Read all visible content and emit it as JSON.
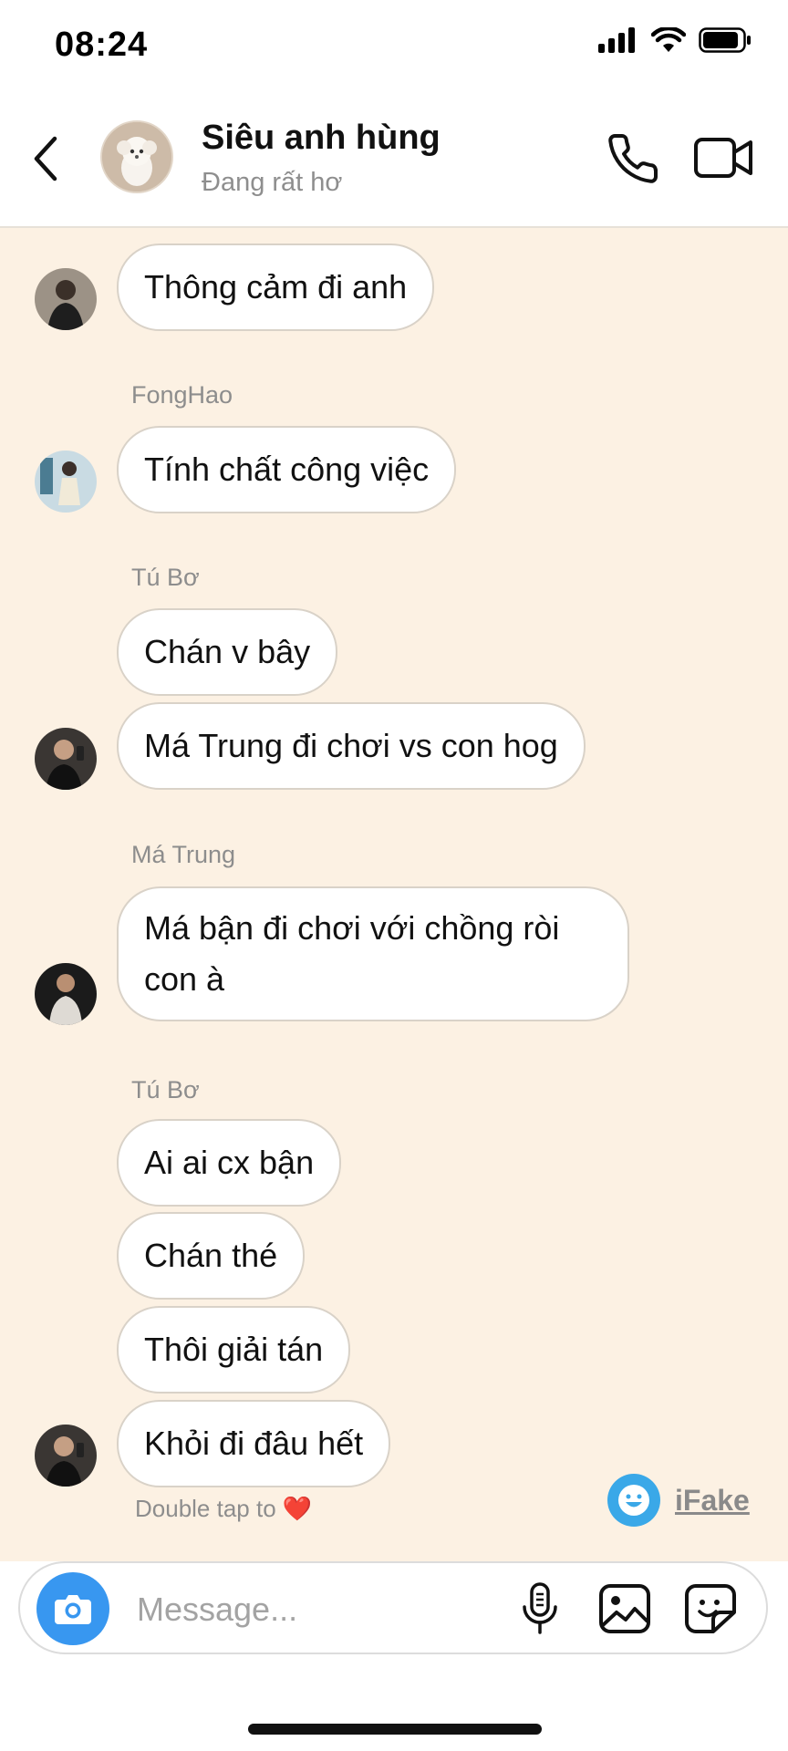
{
  "status_bar": {
    "time": "08:24"
  },
  "header": {
    "title": "Siêu anh hùng",
    "status": "Đang rất hơ"
  },
  "messages": [
    {
      "text": "Thông cảm đi anh"
    },
    {
      "sender": "FongHao",
      "text": "Tính chất công việc"
    },
    {
      "sender": "Tú Bơ",
      "text": "Chán v bây"
    },
    {
      "text": "Má Trung đi chơi vs con hog"
    },
    {
      "sender": "Má Trung",
      "text": "Má bận đi chơi với chồng ròi con à"
    },
    {
      "sender": "Tú Bơ",
      "text": "Ai ai cx bận"
    },
    {
      "text": "Chán thé"
    },
    {
      "text": "Thôi giải tán"
    },
    {
      "text": "Khỏi đi đâu hết"
    }
  ],
  "double_tap": {
    "text": "Double tap to",
    "heart": "❤️"
  },
  "watermark": {
    "text": "iFake"
  },
  "composer": {
    "placeholder": "Message..."
  },
  "icons": {
    "back": "chevron-left-icon",
    "call": "phone-icon",
    "video": "video-camera-icon",
    "camera": "camera-icon",
    "mic": "microphone-icon",
    "gallery": "image-icon",
    "sticker": "sticker-icon"
  },
  "colors": {
    "chat_background": "#fcf1e3",
    "camera_button": "#3897f0",
    "bubble_border": "#d9d2c8"
  }
}
